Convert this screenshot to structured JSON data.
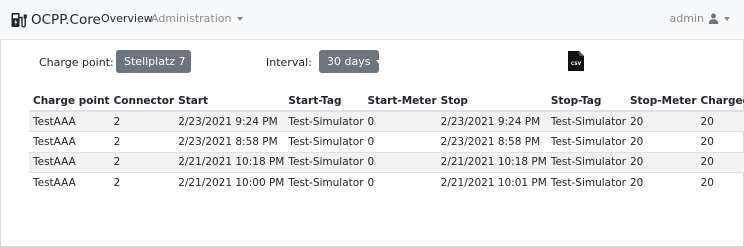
{
  "navbar": {
    "brand": "OCPP.Core",
    "links": {
      "overview": "Overview",
      "administration": "Administration"
    },
    "user": "admin"
  },
  "filters": {
    "charge_point_label": "Charge point:",
    "charge_point_value": "Stellplatz 7",
    "interval_label": "Interval:",
    "interval_value": "30 days",
    "export_icon": "csv-file-icon",
    "export_icon_text": "CSV"
  },
  "table": {
    "headers": [
      "Charge point",
      "Connector",
      "Start",
      "Start-Tag",
      "Start-Meter",
      "Stop",
      "Stop-Tag",
      "Stop-Meter",
      "Charged"
    ],
    "rows": [
      [
        "TestAAA",
        "2",
        "2/23/2021 9:24 PM",
        "Test-Simulator",
        "0",
        "2/23/2021 9:24 PM",
        "Test-Simulator",
        "20",
        "20"
      ],
      [
        "TestAAA",
        "2",
        "2/23/2021 8:58 PM",
        "Test-Simulator",
        "0",
        "2/23/2021 8:58 PM",
        "Test-Simulator",
        "20",
        "20"
      ],
      [
        "TestAAA",
        "2",
        "2/21/2021 10:18 PM",
        "Test-Simulator",
        "0",
        "2/21/2021 10:18 PM",
        "Test-Simulator",
        "20",
        "20"
      ],
      [
        "TestAAA",
        "2",
        "2/21/2021 10:00 PM",
        "Test-Simulator",
        "0",
        "2/21/2021 10:01 PM",
        "Test-Simulator",
        "20",
        "20"
      ]
    ]
  },
  "colors": {
    "navbar_bg": "#f8f9fa",
    "button_bg": "#6c757d",
    "stripe_bg": "#f2f2f2",
    "muted_text": "#8a8a8a"
  }
}
